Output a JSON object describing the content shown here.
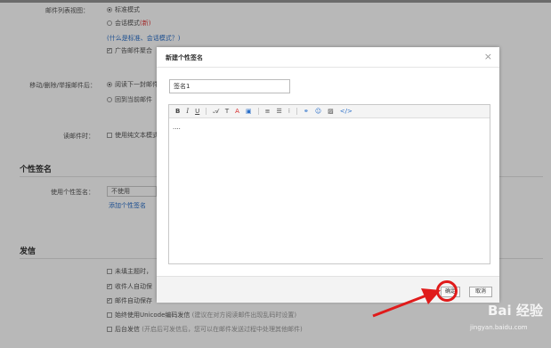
{
  "settings": {
    "list_mode": {
      "label": "邮件列表视图：",
      "option_standard": "标准模式",
      "option_conversation": "会话模式",
      "new_badge": "(新)",
      "help_link": "(什么是标准、会话模式？)",
      "ad_merge": "广告邮件聚合"
    },
    "after_delete": {
      "label": "移动/删除/举报邮件后：",
      "option_next": "阅读下一封邮件",
      "option_back": "回到当前邮件"
    },
    "read_mail": {
      "label": "读邮件时：",
      "option_plain": "使用纯文本模式"
    },
    "signature_section": "个性签名",
    "use_signature": {
      "label": "使用个性签名：",
      "select_value": "不使用",
      "add_link": "添加个性签名"
    },
    "send_section": "发信",
    "send": {
      "no_subject": "未填主题时，",
      "auto_save_contacts": "收件人自动保",
      "auto_save_sent": "邮件自动保存",
      "unicode": "始终使用Unicode编码发信",
      "unicode_hint": "(建议在对方阅读邮件出现乱码时设置)",
      "background_send": "后台发信",
      "background_hint": "(开启后可发信后，您可以在邮件发送过程中处理其他邮件)"
    }
  },
  "dialog": {
    "title": "新建个性签名",
    "close_glyph": "×",
    "name_value": "签名1",
    "editor_content": "....",
    "toolbar": {
      "bold": "B",
      "italic": "I",
      "underline": "U",
      "font": "𝒜",
      "size": "T",
      "color": "A",
      "bg": "▣",
      "align": "≡",
      "list": "☰",
      "indent": "⁝",
      "link": "⚭",
      "emoji": "☺",
      "image": "▨",
      "source": "</>"
    },
    "ok_label": "确定",
    "cancel_label": "取消"
  },
  "watermark": {
    "text": "Bai 经验",
    "url": "jingyan.baidu.com"
  },
  "colors": {
    "annotation_red": "#e01b1b",
    "link_blue": "#2a6fc9",
    "badge_red": "#e03a3a"
  }
}
